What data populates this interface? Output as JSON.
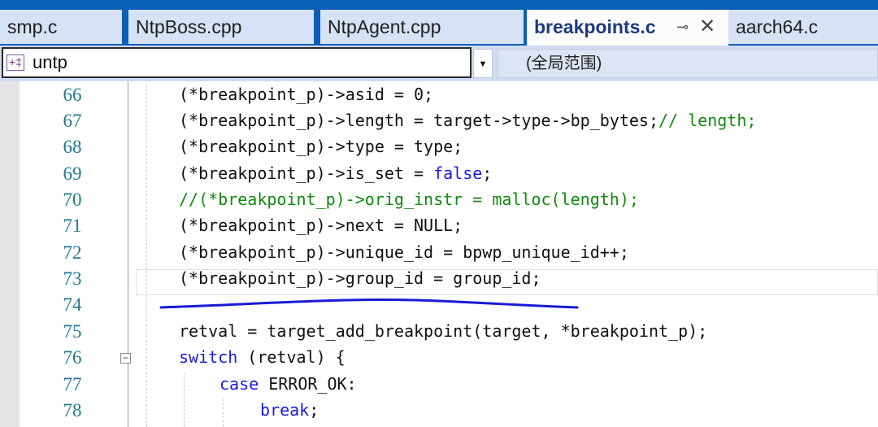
{
  "tabs": [
    {
      "label": "smp.c"
    },
    {
      "label": "NtpBoss.cpp"
    },
    {
      "label": "NtpAgent.cpp"
    },
    {
      "label": "breakpoints.c"
    },
    {
      "label": "aarch64.c"
    }
  ],
  "active_tab": "breakpoints.c",
  "tab_pin_glyph": "⊸",
  "tab_close_glyph": "✕",
  "nav": {
    "scope_icon": "+‡",
    "scope_value": "untp",
    "dropdown_glyph": "▼",
    "function_scope": "(全局范围)"
  },
  "editor": {
    "lines": [
      {
        "num": "66",
        "segs": [
          [
            "",
            "(*breakpoint_p)->asid = 0;"
          ]
        ]
      },
      {
        "num": "67",
        "segs": [
          [
            "",
            "(*breakpoint_p)->length = target->type->bp_bytes;"
          ],
          [
            "cm",
            "// length;"
          ]
        ]
      },
      {
        "num": "68",
        "segs": [
          [
            "",
            "(*breakpoint_p)->type = type;"
          ]
        ]
      },
      {
        "num": "69",
        "segs": [
          [
            "",
            "(*breakpoint_p)->is_set = "
          ],
          [
            "kw",
            "false"
          ],
          [
            "",
            ";"
          ]
        ]
      },
      {
        "num": "70",
        "segs": [
          [
            "cm",
            "//(*breakpoint_p)->orig_instr = malloc(length);"
          ]
        ]
      },
      {
        "num": "71",
        "segs": [
          [
            "",
            "(*breakpoint_p)->next = NULL;"
          ]
        ]
      },
      {
        "num": "72",
        "segs": [
          [
            "",
            "(*breakpoint_p)->unique_id = bpwp_unique_id++;"
          ]
        ]
      },
      {
        "num": "73",
        "segs": [
          [
            "",
            "(*breakpoint_p)->group_id = group_id;"
          ]
        ]
      },
      {
        "num": "74",
        "segs": []
      },
      {
        "num": "75",
        "segs": [
          [
            "",
            "retval = target_add_breakpoint(target, *breakpoint_p);"
          ]
        ]
      },
      {
        "num": "76",
        "segs": [
          [
            "kw",
            "switch"
          ],
          [
            "",
            " (retval) {"
          ]
        ]
      },
      {
        "num": "77",
        "segs": [
          [
            "kw",
            "case"
          ],
          [
            "",
            " ERROR_OK:"
          ]
        ]
      },
      {
        "num": "78",
        "segs": [
          [
            "kw",
            "break"
          ],
          [
            "",
            ";"
          ]
        ]
      }
    ],
    "fold_glyph": "−",
    "annotation_color": "#1a1ad6"
  }
}
